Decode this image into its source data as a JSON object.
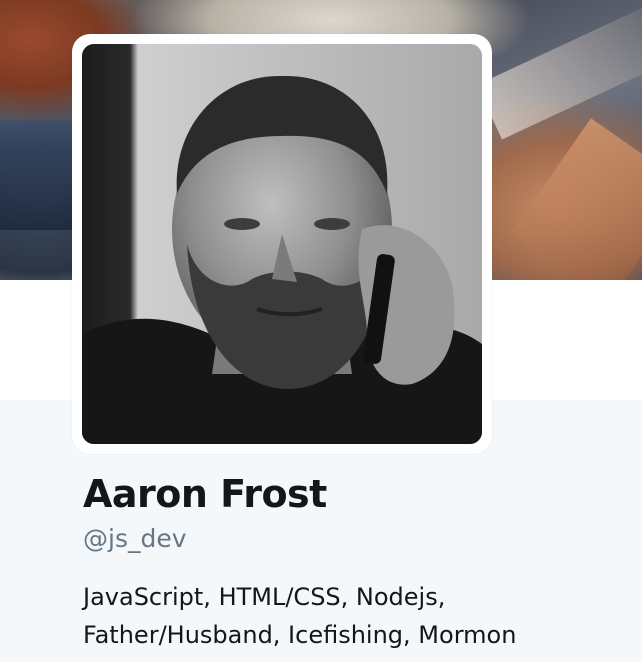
{
  "profile": {
    "name": "Aaron Frost",
    "handle": "@js_dev",
    "bio_lines": [
      "JavaScript, HTML/CSS, Nodejs,",
      "Father/Husband, Icefishing, Mormon"
    ]
  },
  "colors": {
    "name_text": "#14171a",
    "handle_text": "#657786",
    "profile_background": "#f5f8fa"
  },
  "icons": {
    "avatar": "profile-photo",
    "banner": "header-photo"
  }
}
